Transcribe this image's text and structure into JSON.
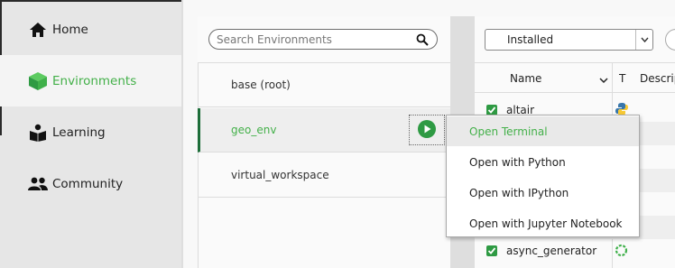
{
  "sidebar": {
    "items": [
      {
        "label": "Home",
        "icon": "home-icon"
      },
      {
        "label": "Environments",
        "icon": "cube-icon"
      },
      {
        "label": "Learning",
        "icon": "book-reader-icon"
      },
      {
        "label": "Community",
        "icon": "people-icon"
      }
    ],
    "active_index": 1
  },
  "environments": {
    "search_placeholder": "Search Environments",
    "list": [
      {
        "name": "base (root)"
      },
      {
        "name": "geo_env",
        "selected": true
      },
      {
        "name": "virtual_workspace"
      }
    ]
  },
  "packages": {
    "filter_selected": "Installed",
    "columns": {
      "name": "Name",
      "type": "T",
      "description": "Descrip"
    },
    "rows": [
      {
        "name": "altair",
        "checked": true,
        "type_icon": "python-icon"
      },
      {
        "name": "async_generator",
        "checked": true,
        "type_icon": "loading-ring-icon"
      }
    ]
  },
  "context_menu": {
    "items": [
      {
        "label": "Open Terminal",
        "highlighted": true
      },
      {
        "label": "Open with Python"
      },
      {
        "label": "Open with IPython"
      },
      {
        "label": "Open with Jupyter Notebook"
      }
    ]
  },
  "colors": {
    "accent": "#43b049",
    "selected_bar": "#1e6e3a",
    "checkbox": "#2e9a43",
    "play_button": "#2e9a43"
  }
}
